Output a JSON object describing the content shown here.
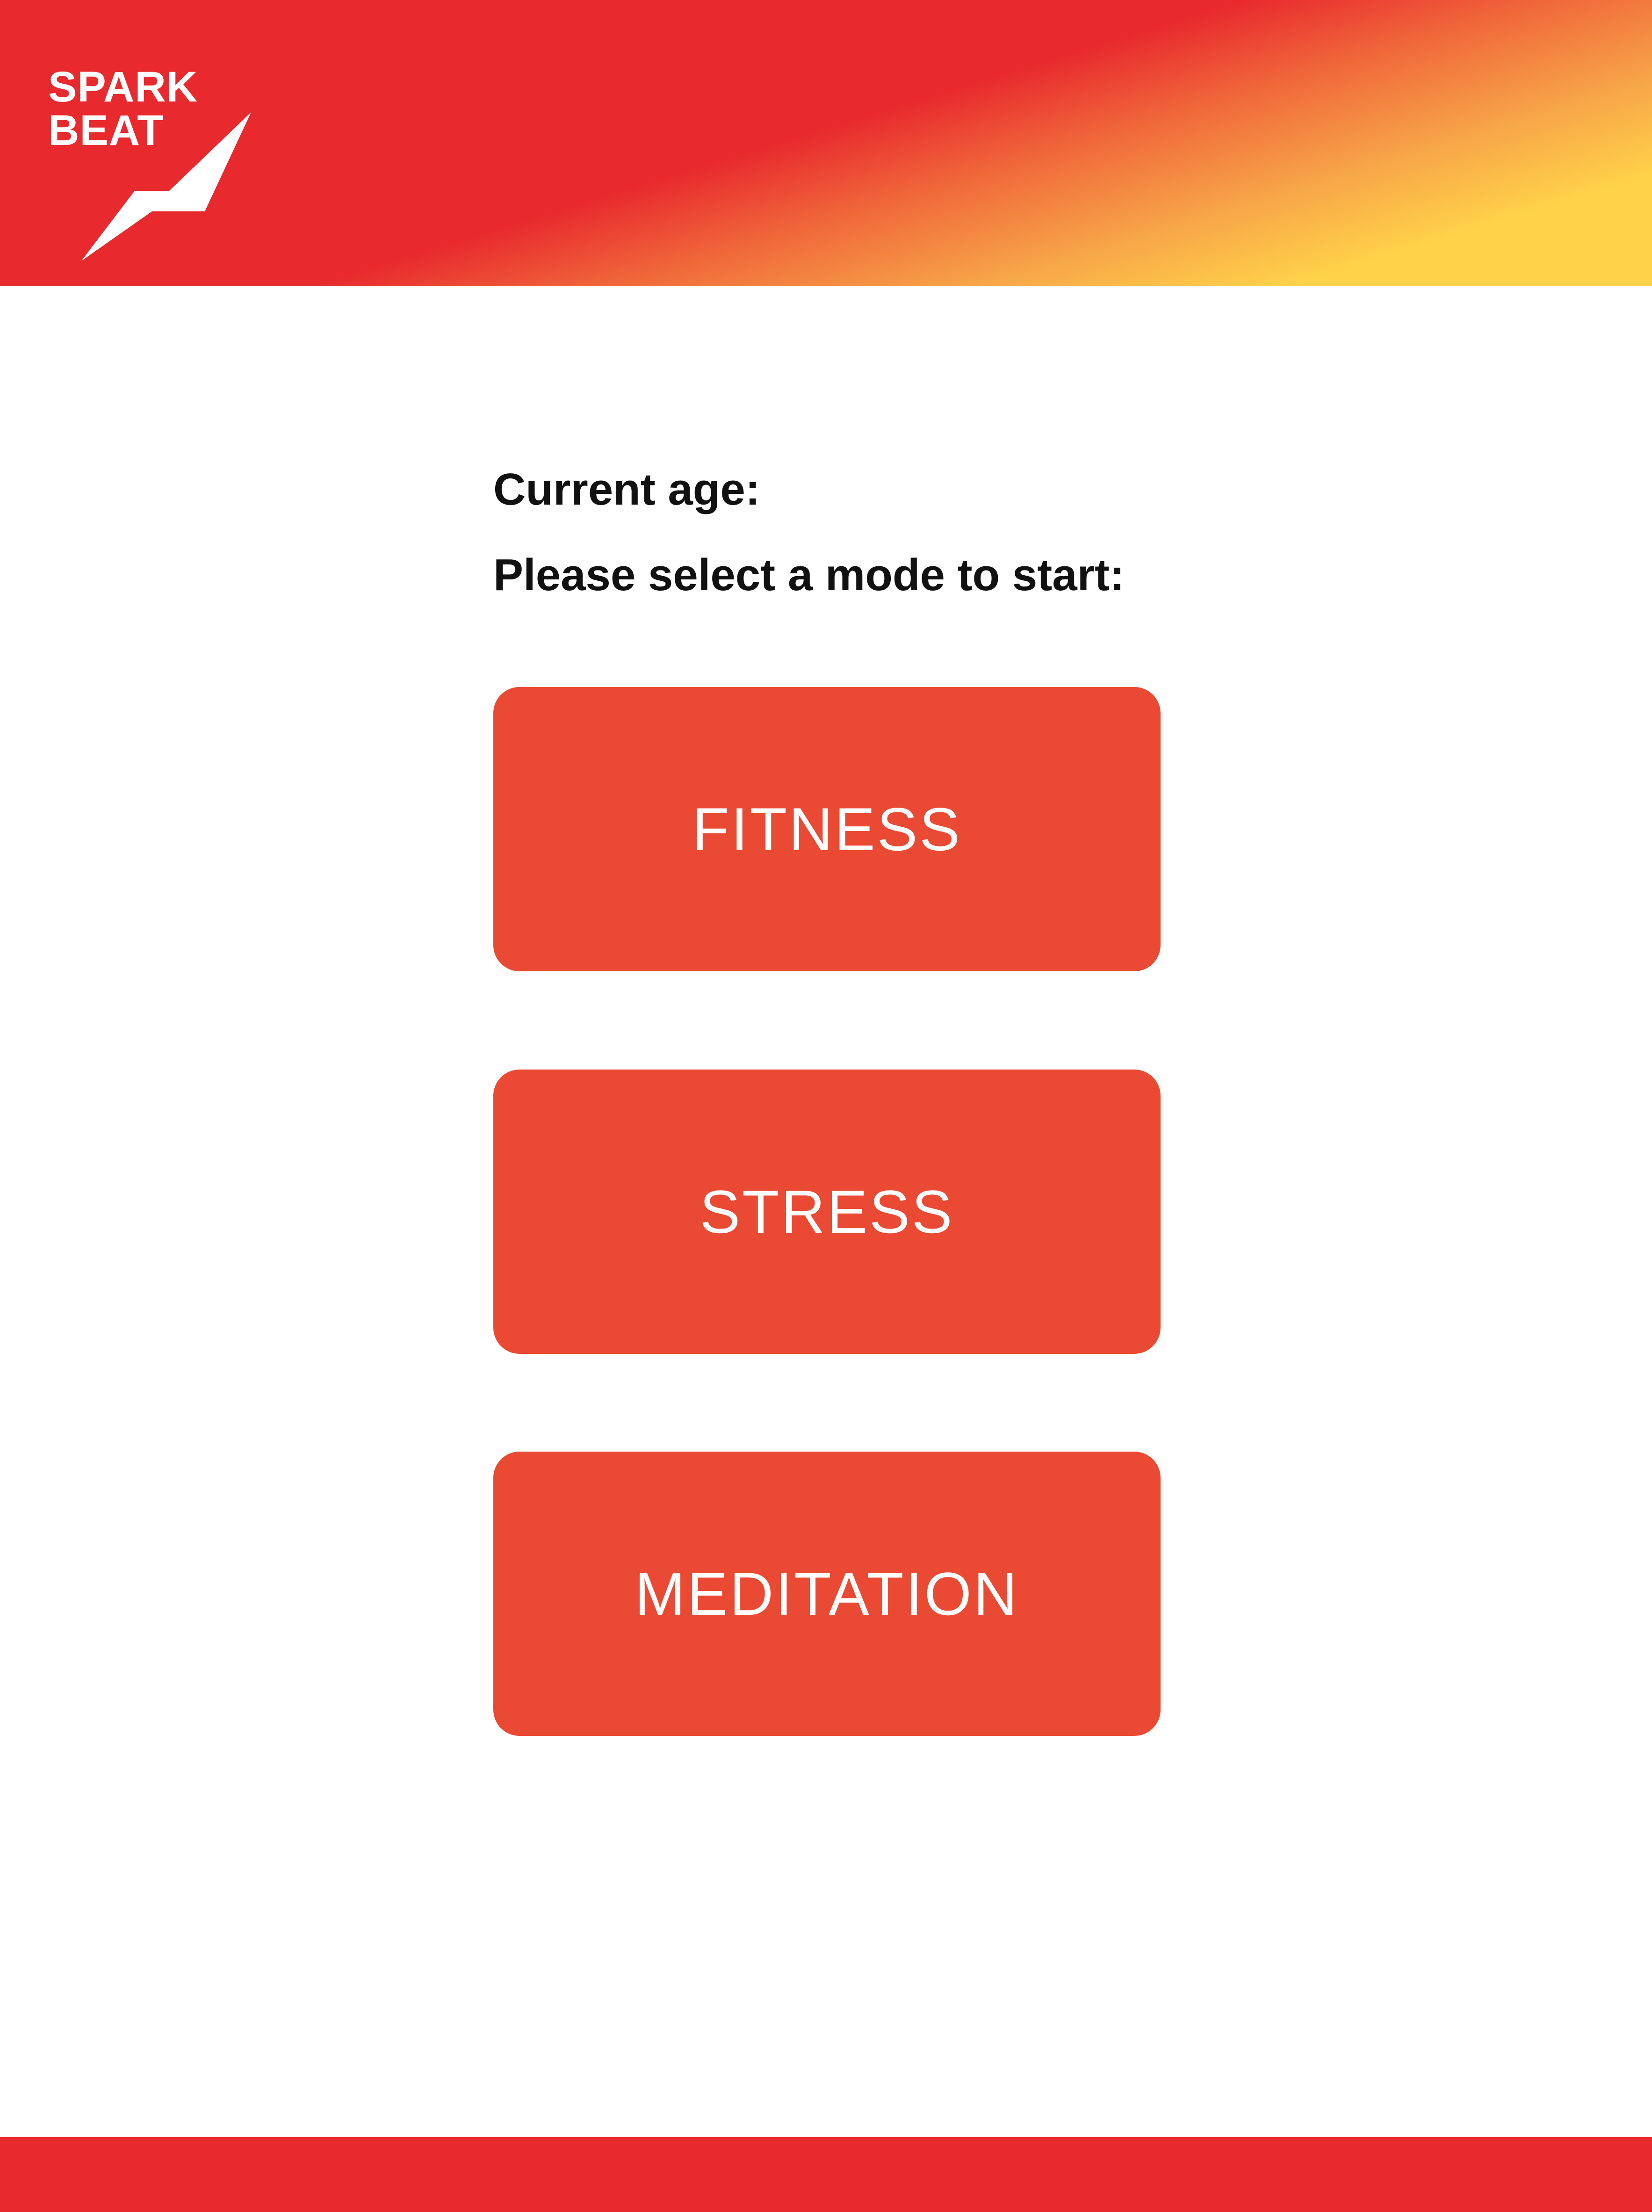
{
  "brand": {
    "line1": "SPARK",
    "line2": "BEAT",
    "logo_icon": "spark-bolt-icon"
  },
  "main": {
    "age_label": "Current age:",
    "prompt": "Please select a mode to start:",
    "modes": [
      {
        "label": "FITNESS"
      },
      {
        "label": "STRESS"
      },
      {
        "label": "MEDITATION"
      }
    ]
  },
  "colors": {
    "brand_red": "#e8292e",
    "button": "#ea4a33",
    "gradient_yellow": "#ffd249",
    "text": "#111111"
  }
}
